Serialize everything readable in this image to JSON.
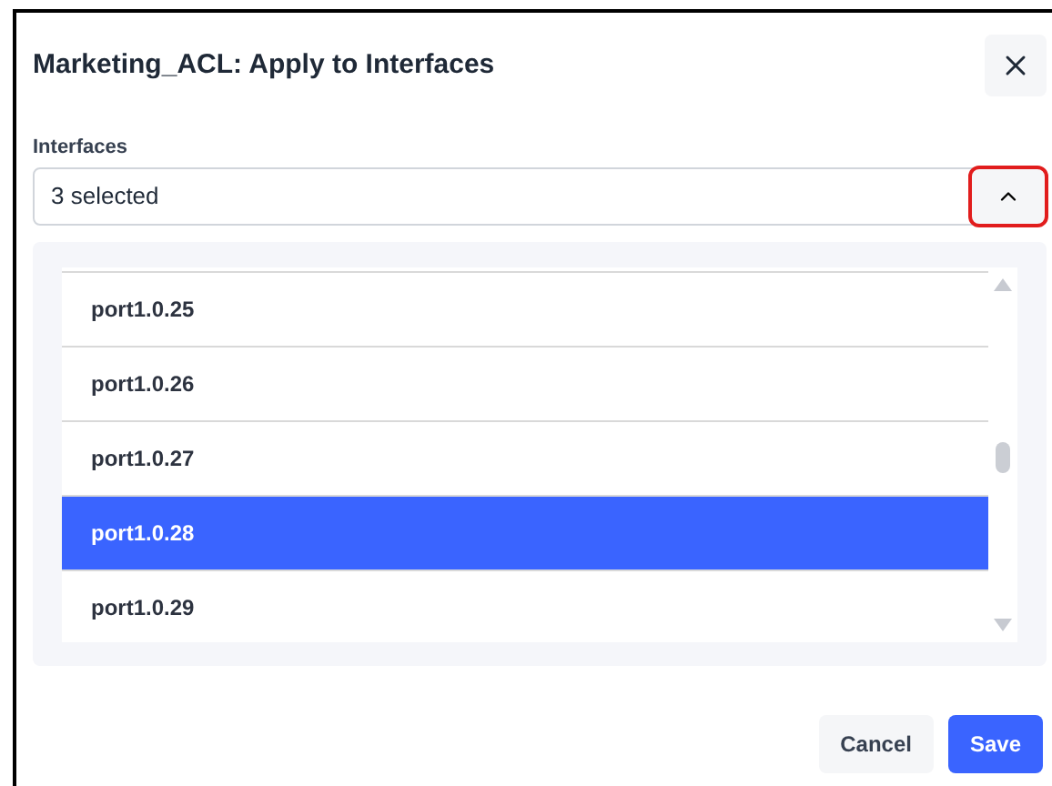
{
  "dialog": {
    "title": "Marketing_ACL: Apply to Interfaces"
  },
  "field": {
    "label": "Interfaces",
    "value": "3 selected",
    "expanded": true
  },
  "options": [
    {
      "label": "port1.0.25",
      "selected": false
    },
    {
      "label": "port1.0.26",
      "selected": false
    },
    {
      "label": "port1.0.27",
      "selected": false
    },
    {
      "label": "port1.0.28",
      "selected": true
    },
    {
      "label": "port1.0.29",
      "selected": false
    }
  ],
  "buttons": [
    {
      "label": "Cancel",
      "kind": "secondary"
    },
    {
      "label": "Save",
      "kind": "primary"
    }
  ]
}
